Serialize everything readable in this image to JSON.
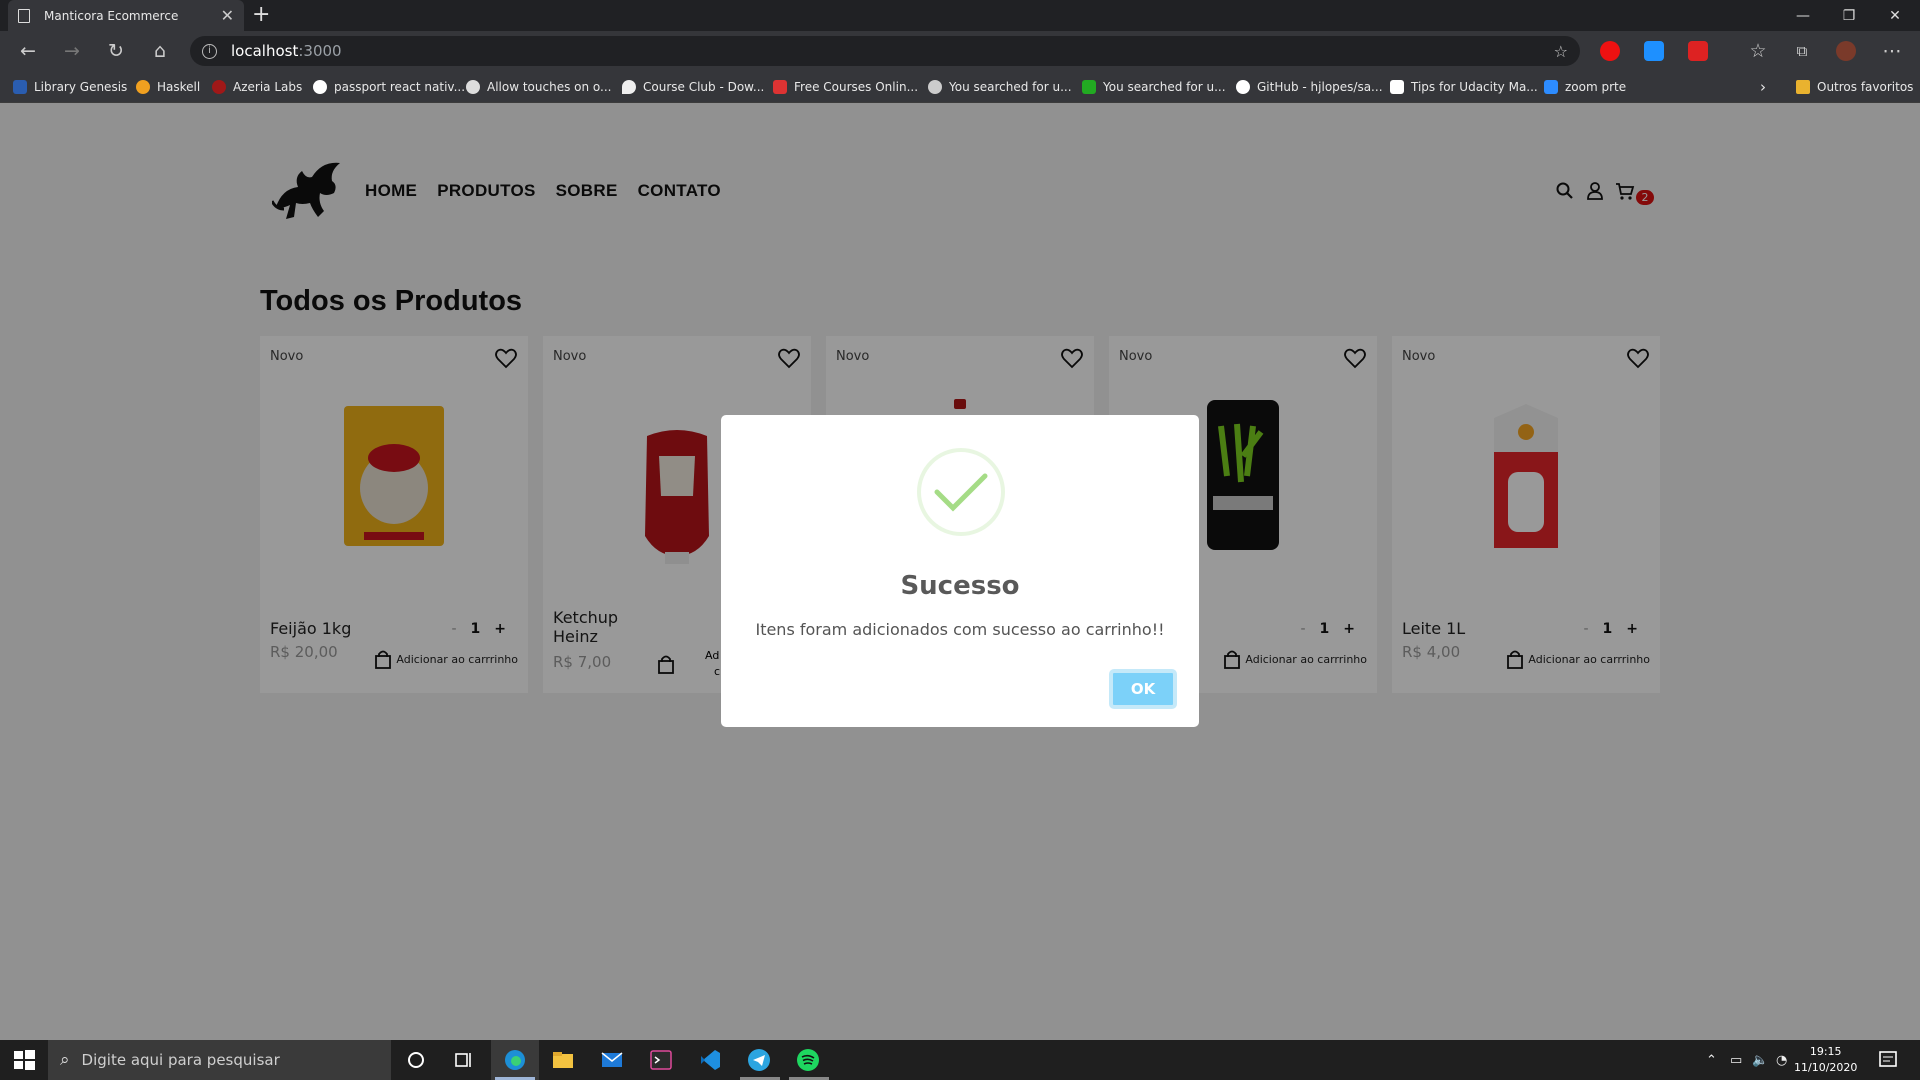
{
  "browser": {
    "tab_title": "Manticora Ecommerce",
    "url_host": "localhost",
    "url_port": ":3000",
    "bookmarks": [
      "Library Genesis",
      "Haskell",
      "Azeria Labs",
      "passport react nativ...",
      "Allow touches on o...",
      "Course Club - Dow...",
      "Free Courses Onlin...",
      "You searched for u...",
      "You searched for u...",
      "GitHub - hjlopes/sa...",
      "Tips for Udacity Ma...",
      "zoom prte"
    ],
    "other_favorites": "Outros favoritos"
  },
  "site": {
    "nav": [
      "HOME",
      "PRODUTOS",
      "SOBRE",
      "CONTATO"
    ],
    "cart_count": "2",
    "section_title": "Todos os Produtos",
    "add_to_cart_label": "Adicionar ao carrrinho",
    "products": [
      {
        "badge": "Novo",
        "name": "Feijão 1kg",
        "price": "R$ 20,00",
        "qty_minus": "-",
        "qty": "1",
        "qty_plus": "+"
      },
      {
        "badge": "Novo",
        "name": "Ketchup Heinz",
        "price": "R$ 7,00"
      },
      {
        "badge": "Novo"
      },
      {
        "badge": "Novo",
        "qty_minus": "-",
        "qty": "1",
        "qty_plus": "+"
      },
      {
        "badge": "Novo",
        "name": "Leite 1L",
        "price": "R$ 4,00",
        "qty_minus": "-",
        "qty": "1",
        "qty_plus": "+"
      }
    ],
    "partial_add_label_1": "Ad",
    "partial_add_label_2": "c"
  },
  "modal": {
    "title": "Sucesso",
    "message": "Itens foram adicionados com sucesso ao carrinho!!",
    "ok_label": "OK",
    "success_color": "#a5dc86",
    "ok_color": "#7cd1f9"
  },
  "taskbar": {
    "search_placeholder": "Digite aqui para pesquisar",
    "time": "19:15",
    "date": "11/10/2020"
  }
}
